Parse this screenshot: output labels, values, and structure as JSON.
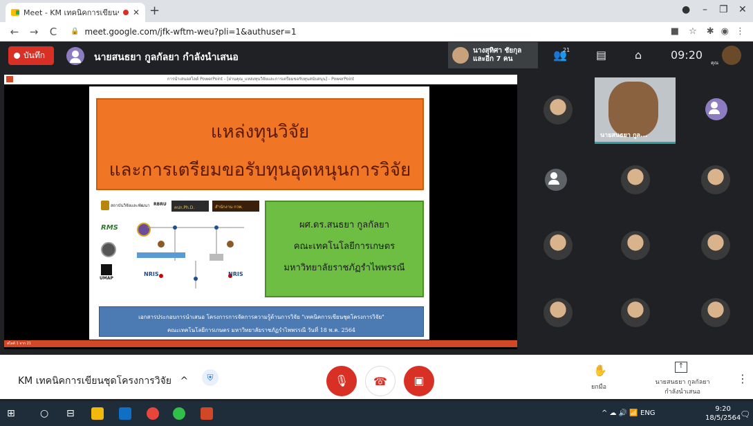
{
  "browser": {
    "tab_title": "Meet - KM เทคนิคการเขียนชุดโครงการวิจัย",
    "tab_close": "✕",
    "new_tab": "+",
    "url": "meet.google.com/jfk-wftm-weu?pli=1&authuser=1",
    "nav_back": "←",
    "nav_forward": "→",
    "nav_reload": "C",
    "win_minimize": "–",
    "win_maximize": "❐",
    "win_close": "✕"
  },
  "meet_top": {
    "record_label": "บันทึก",
    "presenting_text": "นายสนธยา กูลกัลยา กำลังนำเสนอ",
    "others_line1": "นางสุทิศา ชัยกุล",
    "others_line2": "และอีก 7 คน",
    "people_count": "21",
    "clock": "09:20",
    "self_label": "คุณ"
  },
  "ppt": {
    "window_title": "การนำเสนอสไลด์ PowerPoint - [ผ่านคุณ_แหล่งทุนวิจัยและการเตรียมขอรับทุนสนับสนุน] - PowerPoint",
    "slide_number": "สไลด์ 1 จาก 21",
    "title_line1": "แหล่งทุนวิจัย",
    "title_line2": "และการเตรียมขอรับทุนอุดหนุนการวิจัย",
    "presenter_name": "ผศ.ดร.สนธยา กูลกัลยา",
    "faculty": "คณะเทคโนโลยีการเกษตร",
    "university": "มหาวิทยาลัยราชภัฏรำไพพรรณี",
    "footer_line1": "เอกสารประกอบการนำเสนอ โครงการการจัดการความรู้ด้านการวิจัย \"เทคนิคการเขียนชุดโครงการวิจัย\"",
    "footer_line2": "คณะเทคโนโลยีการเกษตร มหาวิทยาลัยราชภัฏรำไพพรรณี    วันที่ 18 พ.ค. 2564",
    "logo_rdi": "สถาบันวิจัยและพัฒนา",
    "logo_rbru": "RBRU",
    "logo_phd": "คปก.Ph.D.",
    "logo_nrct": "สำนักงาน กวพ.",
    "logo_rms": "RMS",
    "logo_umap": "UMAP",
    "logo_nris": "NRIS"
  },
  "participants": {
    "active_speaker": "นายสนธยา กูล..."
  },
  "bottom": {
    "meeting_name": "KM เทคนิคการเขียนชุดโครงการวิจัย",
    "chevron": "^",
    "raise_hand": "ยกมือ",
    "presenting_label1": "นายสนธยา กูลกัลยา",
    "presenting_label2": "กำลังนำเสนอ"
  },
  "taskbar": {
    "lang": "ENG",
    "time": "9:20",
    "date": "18/5/2564"
  },
  "colors": {
    "record_red": "#d93025",
    "title_orange": "#f07524",
    "green_box": "#6fbe44",
    "footer_blue": "#4c7ab3"
  }
}
